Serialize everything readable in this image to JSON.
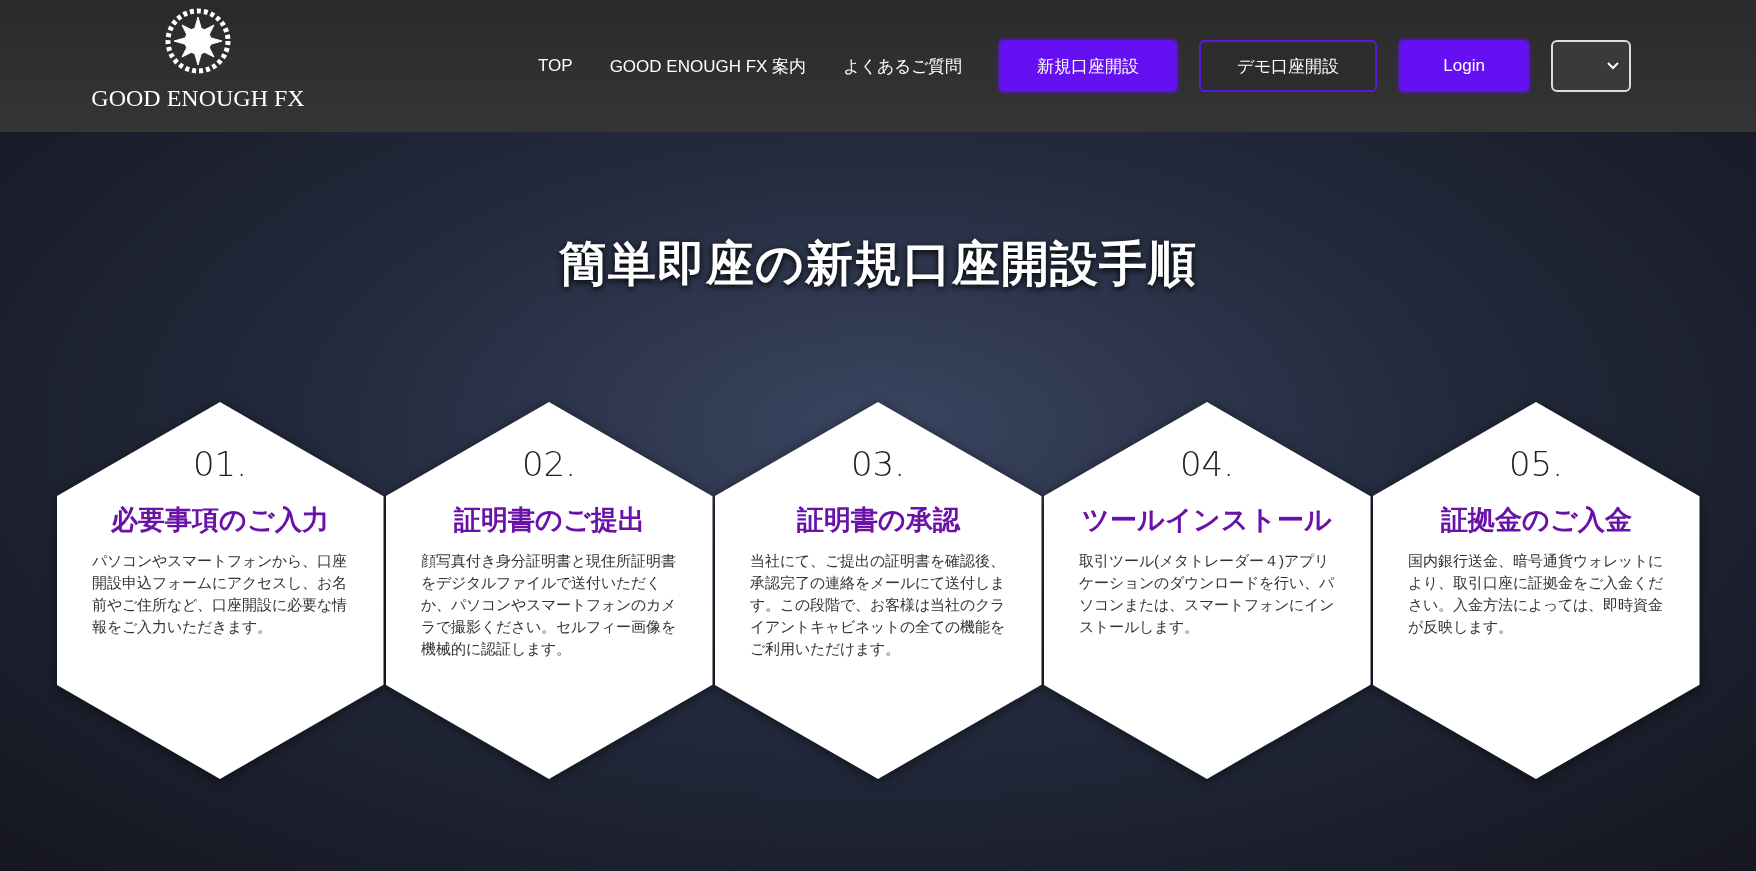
{
  "header": {
    "brand": "GOOD ENOUGH FX",
    "nav": [
      "TOP",
      "GOOD ENOUGH FX 案内",
      "よくあるご質問"
    ],
    "buttons": [
      {
        "label": "新規口座開設",
        "kind": "filled"
      },
      {
        "label": "デモ口座開設",
        "kind": "outline"
      },
      {
        "label": "Login",
        "kind": "filled"
      }
    ]
  },
  "hero": {
    "title": "簡単即座の新規口座開設手順",
    "steps": [
      {
        "number": "01.",
        "title": "必要事項のご入力",
        "text": "パソコンやスマートフォンから、口座開設申込フォームにアクセスし、お名前やご住所など、口座開設に必要な情報をご入力いただきます。"
      },
      {
        "number": "02.",
        "title": "証明書のご提出",
        "text": "顔写真付き身分証明書と現住所証明書をデジタルファイルで送付いただくか、パソコンやスマートフォンのカメラで撮影ください。セルフィー画像を機械的に認証します。"
      },
      {
        "number": "03.",
        "title": "証明書の承認",
        "text": "当社にて、ご提出の証明書を確認後、承認完了の連絡をメールにて送付します。この段階で、お客様は当社のクライアントキャビネットの全ての機能をご利用いただけます。"
      },
      {
        "number": "04.",
        "title": "ツールインストール",
        "text": "取引ツール(メタトレーダー４)アプリケーションのダウンロードを行い、パソコンまたは、スマートフォンにインストールします。"
      },
      {
        "number": "05.",
        "title": "証拠金のご入金",
        "text": "国内銀行送金、暗号通貨ウォレットにより、取引口座に証拠金をご入金ください。入金方法によっては、即時資金が反映します。"
      }
    ]
  }
}
